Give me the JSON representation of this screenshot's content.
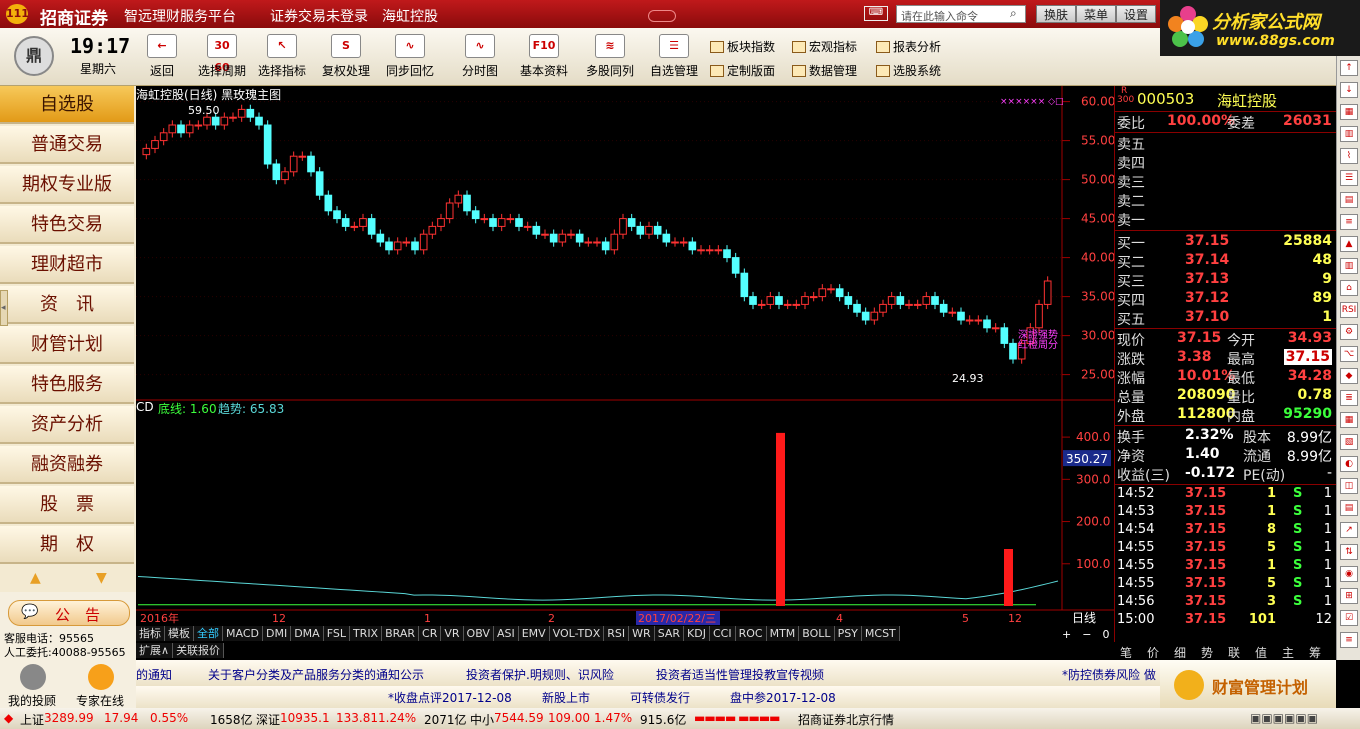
{
  "titlebar": {
    "brand": "招商证券",
    "platform": "智远理财服务平台",
    "login_status": "证券交易未登录",
    "stock_title": "海虹控股",
    "command_placeholder": "请在此输入命令",
    "buttons": [
      "换肤",
      "菜单",
      "设置"
    ]
  },
  "ad": {
    "line1": "分析家公式网",
    "line2": "www.88gs.com"
  },
  "clock": {
    "time": "19:17",
    "weekday": "星期六"
  },
  "toolbar": {
    "big": [
      {
        "label": "返回",
        "icon": "back-arrow-icon",
        "glyph": "←"
      },
      {
        "label": "选择周期",
        "icon": "calendar-icon",
        "glyph": "30 60"
      },
      {
        "label": "选择指标",
        "icon": "cursor-icon",
        "glyph": "↖"
      },
      {
        "label": "复权处理",
        "icon": "adjust-icon",
        "glyph": "S"
      },
      {
        "label": "同步回忆",
        "icon": "sync-icon",
        "glyph": "∿"
      },
      {
        "label": "分时图",
        "icon": "intraday-icon",
        "glyph": "∿"
      },
      {
        "label": "基本资料",
        "icon": "f10-icon",
        "glyph": "F10"
      },
      {
        "label": "多股同列",
        "icon": "multi-stock-icon",
        "glyph": "≋"
      },
      {
        "label": "自选管理",
        "icon": "watchlist-icon",
        "glyph": "☰"
      }
    ],
    "small": [
      {
        "label": "板块指数",
        "icon": "sector-index-icon"
      },
      {
        "label": "宏观指标",
        "icon": "macro-icon"
      },
      {
        "label": "报表分析",
        "icon": "report-icon"
      },
      {
        "label": "定制版面",
        "icon": "layout-icon"
      },
      {
        "label": "数据管理",
        "icon": "data-icon"
      },
      {
        "label": "选股系统",
        "icon": "screener-icon"
      }
    ]
  },
  "nav": [
    "自选股",
    "普通交易",
    "期权专业版",
    "特色交易",
    "理财超市",
    "资　讯",
    "财管计划",
    "特色服务",
    "资产分析",
    "融资融券",
    "股　票",
    "期　权"
  ],
  "leftbottom": {
    "notice": "公　告",
    "phone": "客服电话：95565",
    "agent": "人工委托:40088-95565",
    "investor": "我的投顾",
    "expert": "专家在线"
  },
  "chart": {
    "title": "海虹控股(日线) 黑玫瑰主图",
    "high_label": "59.50",
    "low_label": "24.93",
    "price_ticks": [
      "60.00",
      "55.00",
      "50.00",
      "45.00",
      "40.00",
      "35.00",
      "30.00",
      "25.00"
    ],
    "overlay_text1": "深證强势",
    "overlay_text2": "红橙周分",
    "indicator_title": "CD",
    "indicator_line1_label": "底线: 1.60",
    "indicator_line2_label": "趋势: 65.83",
    "indicator_ticks": [
      "400.0",
      "300.0",
      "200.0",
      "100.0"
    ],
    "indicator_current": "350.27",
    "xaxis": {
      "labels": [
        "2016年",
        "12",
        "1",
        "2",
        "2017/02/22/三",
        "4",
        "5",
        "12"
      ],
      "period": "日线"
    }
  },
  "chart_data": {
    "type": "candlestick",
    "title": "海虹控股(日线) 黑玫瑰主图",
    "ylim": [
      22,
      62
    ],
    "high": 59.5,
    "low": 24.93,
    "close_series": [
      54,
      55,
      56,
      57,
      56,
      57,
      57,
      58,
      57,
      58,
      58,
      59,
      58,
      57,
      52,
      50,
      51,
      53,
      53,
      51,
      48,
      46,
      45,
      44,
      44,
      45,
      43,
      42,
      41,
      42,
      42,
      41,
      43,
      44,
      45,
      47,
      48,
      46,
      45,
      45,
      44,
      45,
      45,
      44,
      44,
      43,
      43,
      42,
      43,
      43,
      42,
      42,
      42,
      41,
      43,
      45,
      44,
      43,
      44,
      43,
      42,
      42,
      42,
      41,
      41,
      41,
      41,
      40,
      38,
      35,
      34,
      34,
      35,
      34,
      34,
      34,
      35,
      35,
      36,
      36,
      35,
      34,
      33,
      32,
      33,
      34,
      35,
      34,
      34,
      34,
      35,
      34,
      33,
      33,
      32,
      32,
      32,
      31,
      31,
      29,
      27,
      29,
      31,
      34,
      37
    ],
    "indicator": {
      "name": "CD",
      "series": [
        {
          "name": "底线",
          "last": 1.6
        },
        {
          "name": "趋势",
          "last": 65.83
        }
      ],
      "ylim": [
        0,
        450
      ],
      "spikes": [
        {
          "x": "2017/03",
          "value": 410
        },
        {
          "x": "2017/12",
          "value": 135
        }
      ]
    }
  },
  "indicator_tabs": [
    "指标",
    "模板",
    "全部",
    "MACD",
    "DMI",
    "DMA",
    "FSL",
    "TRIX",
    "BRAR",
    "CR",
    "VR",
    "OBV",
    "ASI",
    "EMV",
    "VOL-TDX",
    "RSI",
    "WR",
    "SAR",
    "KDJ",
    "CCI",
    "ROC",
    "MTM",
    "BOLL",
    "PSY",
    "MCST"
  ],
  "subtabs": [
    "扩展∧",
    "关联报价"
  ],
  "quote": {
    "code": "000503",
    "name": "海虹控股",
    "r_tag": "R",
    "r_num": "300",
    "weibi_label": "委比",
    "weibi": "100.00%",
    "weicha_label": "委差",
    "weicha": "26031",
    "asks": [
      {
        "label": "卖五"
      },
      {
        "label": "卖四"
      },
      {
        "label": "卖三"
      },
      {
        "label": "卖二"
      },
      {
        "label": "卖一"
      }
    ],
    "bids": [
      {
        "label": "买一",
        "price": "37.15",
        "vol": "25884"
      },
      {
        "label": "买二",
        "price": "37.14",
        "vol": "48"
      },
      {
        "label": "买三",
        "price": "37.13",
        "vol": "9"
      },
      {
        "label": "买四",
        "price": "37.12",
        "vol": "89"
      },
      {
        "label": "买五",
        "price": "37.10",
        "vol": "1"
      }
    ],
    "stats": [
      {
        "l1": "现价",
        "v1": "37.15",
        "l2": "今开",
        "v2": "34.93"
      },
      {
        "l1": "涨跌",
        "v1": "3.38",
        "l2": "最高",
        "v2": "37.15"
      },
      {
        "l1": "涨幅",
        "v1": "10.01%",
        "l2": "最低",
        "v2": "34.28"
      },
      {
        "l1": "总量",
        "v1": "208090",
        "l2": "量比",
        "v2": "0.78"
      },
      {
        "l1": "外盘",
        "v1": "112800",
        "l2": "内盘",
        "v2": "95290"
      }
    ],
    "finance": [
      {
        "l1": "换手",
        "v1": "2.32%",
        "l2": "股本",
        "v2": "8.99亿"
      },
      {
        "l1": "净资",
        "v1": "1.40",
        "l2": "流通",
        "v2": "8.99亿"
      },
      {
        "l1": "收益(三)",
        "v1": "-0.172",
        "l2": "PE(动)",
        "v2": "-"
      }
    ],
    "ticks": [
      {
        "time": "14:52",
        "price": "37.15",
        "vol": "1",
        "side": "S",
        "n": "1"
      },
      {
        "time": "14:53",
        "price": "37.15",
        "vol": "1",
        "side": "S",
        "n": "1"
      },
      {
        "time": "14:54",
        "price": "37.15",
        "vol": "8",
        "side": "S",
        "n": "1"
      },
      {
        "time": "14:55",
        "price": "37.15",
        "vol": "5",
        "side": "S",
        "n": "1"
      },
      {
        "time": "14:55",
        "price": "37.15",
        "vol": "1",
        "side": "S",
        "n": "1"
      },
      {
        "time": "14:55",
        "price": "37.15",
        "vol": "5",
        "side": "S",
        "n": "1"
      },
      {
        "time": "14:56",
        "price": "37.15",
        "vol": "3",
        "side": "S",
        "n": "1"
      },
      {
        "time": "15:00",
        "price": "37.15",
        "vol": "101",
        "side": "",
        "n": "12"
      }
    ],
    "bottom_tabs": [
      "笔",
      "价",
      "细",
      "势",
      "联",
      "值",
      "主",
      "筹"
    ]
  },
  "news1": [
    "的通知",
    "关于客户分类及产品服务分类的通知公示",
    "投资者保护.明规则、识风险",
    "投资者适当性管理投教宣传视频",
    "*防控债券风险  做"
  ],
  "news2": [
    "*收盘点评2017-12-08",
    "新股上市",
    "可转债发行",
    "盘中参2017-12-08"
  ],
  "wealth": "财富管理计划",
  "status": {
    "sh_label": "上证",
    "sh_val": "3289.99",
    "sh_chg": "17.94",
    "sh_pct": "0.55%",
    "sh_amt": "1658亿",
    "sz_label": "深证",
    "sz_val": "10935.1",
    "sz_chg": "133.81",
    "sz_pct": "1.24%",
    "sz_amt": "2071亿",
    "zx_label": "中小",
    "zx_val": "7544.59",
    "zx_chg": "109.00",
    "zx_pct": "1.47%",
    "zx_amt": "915.6亿",
    "server": "招商证券北京行情"
  }
}
